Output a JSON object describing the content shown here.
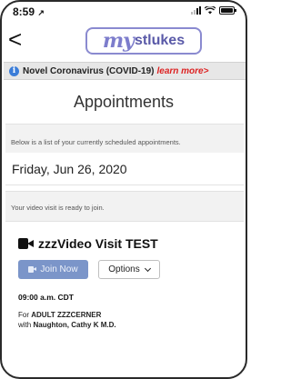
{
  "status_bar": {
    "time": "8:59",
    "location_glyph": "↗"
  },
  "header": {
    "back_glyph": "<",
    "logo_my": "my",
    "logo_rest": "stlukes"
  },
  "alert": {
    "text": "Novel Coronavirus (COVID-19)",
    "link": "learn more>"
  },
  "page": {
    "title": "Appointments",
    "intro": "Below is a list of your currently scheduled appointments.",
    "date": "Friday, Jun 26, 2020",
    "ready_notice": "Your video visit is ready to join."
  },
  "appointment": {
    "title": "zzzVideo Visit TEST",
    "join_label": "Join Now",
    "options_label": "Options",
    "time": "09:00 a.m. CDT",
    "for_prefix": "For",
    "patient": "ADULT ZZZCERNER",
    "with_prefix": "with",
    "provider": "Naughton, Cathy K M.D."
  },
  "colors": {
    "accent": "#7b95c9",
    "logo": "#7d7dcc",
    "alert_link": "#dd2222",
    "info": "#3b7dd8"
  }
}
